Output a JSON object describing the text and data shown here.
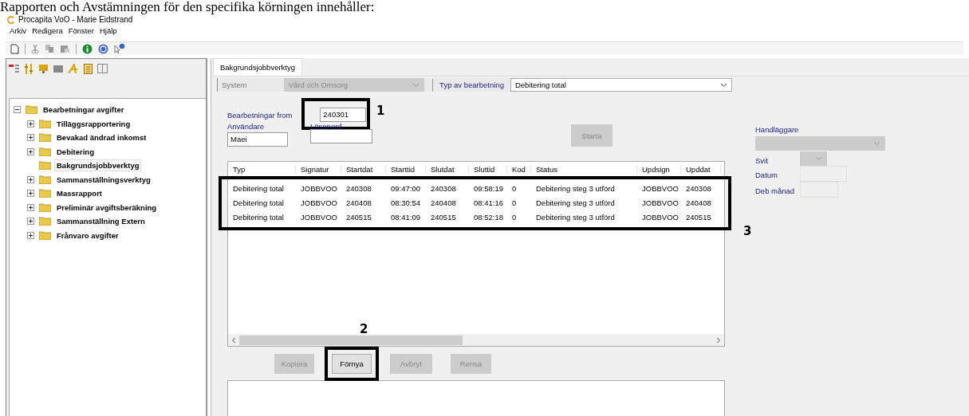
{
  "document_heading": "Rapporten och Avstämningen för den specifika körningen innehåller:",
  "window": {
    "title": "Procapita VoO - Marie Eidstrand"
  },
  "menu": [
    "Arkiv",
    "Redigera",
    "Fönster",
    "Hjälp"
  ],
  "sidebar": {
    "tree": [
      {
        "label": "Bearbetningar avgifter",
        "expanded": true,
        "selected": false,
        "children": [
          {
            "label": "Tilläggsrapportering",
            "expanded": false,
            "selected": false,
            "kind": "folder"
          },
          {
            "label": "Bevakad ändrad inkomst",
            "expanded": false,
            "selected": false,
            "kind": "folder"
          },
          {
            "label": "Debitering",
            "expanded": false,
            "selected": false,
            "kind": "folder"
          },
          {
            "label": "Bakgrundsjobbverktyg",
            "selected": true,
            "kind": "leaf"
          },
          {
            "label": "Sammanställningsverktyg",
            "expanded": false,
            "selected": false,
            "kind": "folder"
          },
          {
            "label": "Massrapport",
            "expanded": false,
            "selected": false,
            "kind": "folder"
          },
          {
            "label": "Preliminär avgiftsberäkning",
            "expanded": false,
            "selected": false,
            "kind": "folder"
          },
          {
            "label": "Sammanställning Extern",
            "expanded": false,
            "selected": false,
            "kind": "folder"
          },
          {
            "label": "Frånvaro avgifter",
            "expanded": false,
            "selected": false,
            "kind": "folder"
          }
        ]
      }
    ]
  },
  "tabs": [
    {
      "label": "Bakgrundsjobbverktyg",
      "selected": true
    }
  ],
  "filters": {
    "system": {
      "label": "System",
      "value": "Vård och Omsorg",
      "disabled": true
    },
    "processing_type": {
      "label": "Typ av bearbetning",
      "value": "Debitering total",
      "disabled": false
    }
  },
  "form": {
    "from": {
      "label": "Bearbetningar from",
      "value": "240301"
    },
    "user": {
      "label": "Användare",
      "value": "Maei"
    },
    "password": {
      "label": "Lösenord"
    },
    "start_button": {
      "label": "Starta",
      "disabled": true
    }
  },
  "side_fields": {
    "case_officer": {
      "label": "Handläggare",
      "disabled": true
    },
    "suite": {
      "label": "Svit",
      "disabled": true
    },
    "date": {
      "label": "Datum"
    },
    "billing_month": {
      "label": "Deb månad"
    }
  },
  "table": {
    "columns": [
      "Typ",
      "Signatur",
      "Startdat",
      "Starttid",
      "Slutdat",
      "Sluttid",
      "Kod",
      "Status",
      "Updsign",
      "Upddat"
    ],
    "rows": [
      [
        "Debitering total",
        "JOBBVOO",
        "240308",
        "09:47:00",
        "240308",
        "09:58:19",
        "0",
        "Debitering steg 3 utförd",
        "JOBBVOO",
        "240308"
      ],
      [
        "Debitering total",
        "JOBBVOO",
        "240408",
        "08:30:54",
        "240408",
        "08:41:16",
        "0",
        "Debitering steg 3 utförd",
        "JOBBVOO",
        "240408"
      ],
      [
        "Debitering total",
        "JOBBVOO",
        "240515",
        "08:41:09",
        "240515",
        "08:52:18",
        "0",
        "Debitering steg 3 utförd",
        "JOBBVOO",
        "240515"
      ]
    ]
  },
  "buttons": [
    {
      "label": "Kopiera",
      "disabled": true
    },
    {
      "label": "Förnya",
      "disabled": false
    },
    {
      "label": "Avbryt",
      "disabled": true
    },
    {
      "label": "Rensa",
      "disabled": true
    }
  ],
  "annotations": [
    "1",
    "2",
    "3"
  ]
}
